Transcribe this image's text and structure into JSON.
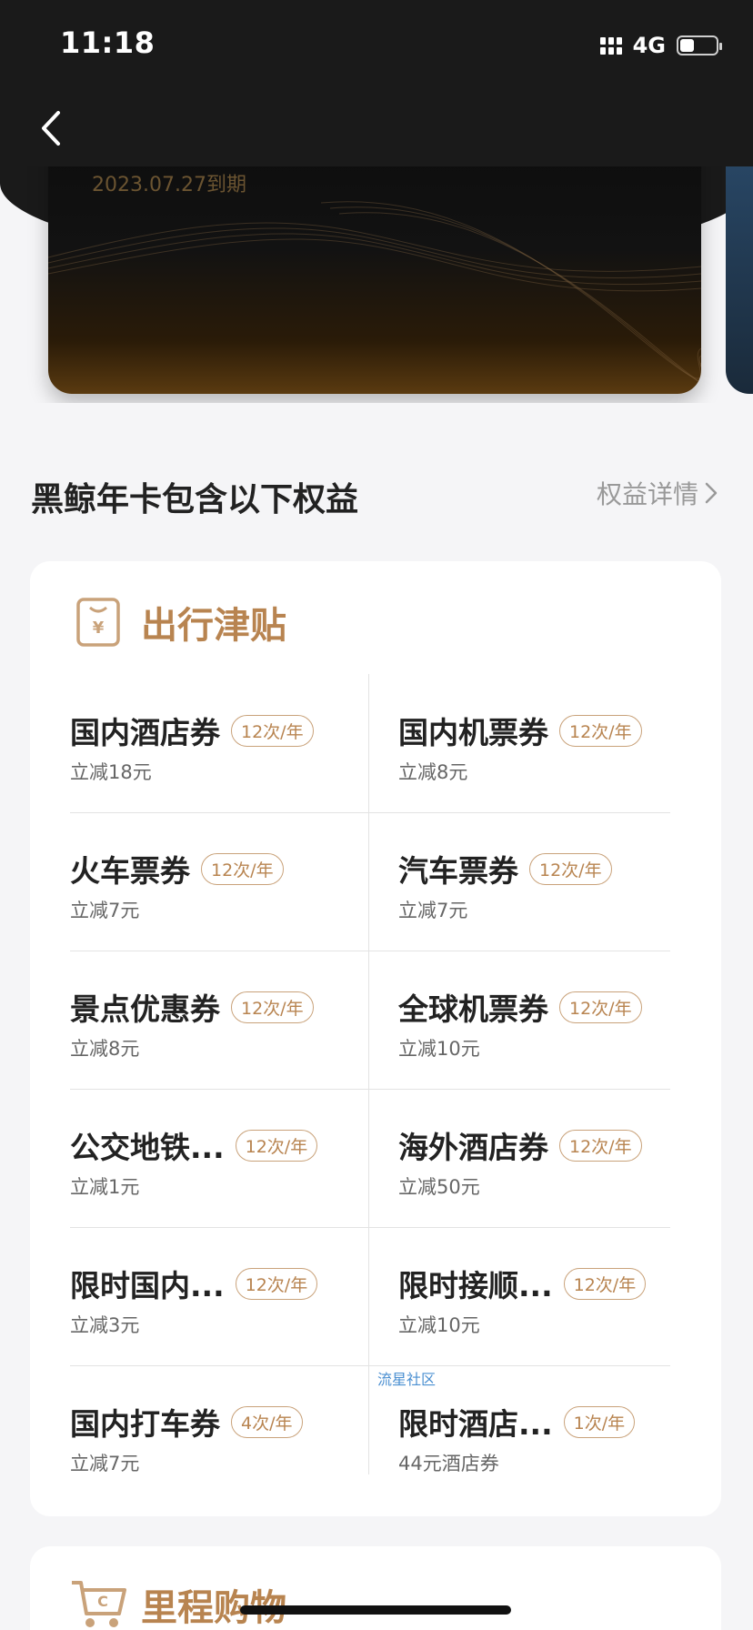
{
  "status_bar": {
    "time": "11:18",
    "network": "4G",
    "battery_level": 0.4
  },
  "card": {
    "expiry_text": "2023.07.27到期"
  },
  "benefits_section": {
    "title": "黑鲸年卡包含以下权益",
    "details_link": "权益详情"
  },
  "travel_panel": {
    "title": "出行津贴",
    "items": [
      {
        "name": "国内酒店券",
        "tag": "12次/年",
        "desc": "立减18元"
      },
      {
        "name": "国内机票券",
        "tag": "12次/年",
        "desc": "立减8元"
      },
      {
        "name": "火车票券",
        "tag": "12次/年",
        "desc": "立减7元"
      },
      {
        "name": "汽车票券",
        "tag": "12次/年",
        "desc": "立减7元"
      },
      {
        "name": "景点优惠券",
        "tag": "12次/年",
        "desc": "立减8元"
      },
      {
        "name": "全球机票券",
        "tag": "12次/年",
        "desc": "立减10元"
      },
      {
        "name": "公交地铁...",
        "tag": "12次/年",
        "desc": "立减1元"
      },
      {
        "name": "海外酒店券",
        "tag": "12次/年",
        "desc": "立减50元"
      },
      {
        "name": "限时国内...",
        "tag": "12次/年",
        "desc": "立减3元"
      },
      {
        "name": "限时接顺...",
        "tag": "12次/年",
        "desc": "立减10元"
      },
      {
        "name": "国内打车券",
        "tag": "4次/年",
        "desc": "立减7元"
      },
      {
        "name": "限时酒店...",
        "tag": "1次/年",
        "desc": "44元酒店券"
      }
    ]
  },
  "watermark": "流星社区",
  "shopping_panel": {
    "title": "里程购物"
  },
  "colors": {
    "header_bg": "#1a1a1a",
    "accent": "#b88450",
    "tag_border": "#c9a27a",
    "page_bg": "#f5f5f7"
  }
}
